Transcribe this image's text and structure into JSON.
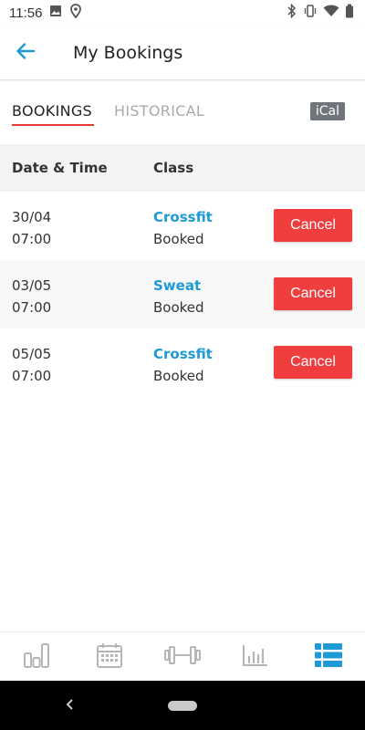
{
  "status_bar": {
    "time": "11:56",
    "left_icons": [
      "image-icon",
      "location-pin-icon"
    ],
    "right_icons": [
      "bluetooth-icon",
      "vibrate-icon",
      "wifi-icon",
      "battery-icon"
    ]
  },
  "app_bar": {
    "title": "My Bookings",
    "back_icon": "arrow-left-icon",
    "accent_color": "#1e9ad6"
  },
  "tabs": {
    "items": [
      {
        "label": "BOOKINGS",
        "active": true
      },
      {
        "label": "HISTORICAL",
        "active": false
      }
    ],
    "ical_label": "iCal",
    "underline_color": "#e53935"
  },
  "table": {
    "headers": {
      "date": "Date & Time",
      "class": "Class"
    },
    "rows": [
      {
        "date": "30/04",
        "time": "07:00",
        "class_name": "Crossfit",
        "status": "Booked",
        "action": "Cancel"
      },
      {
        "date": "03/05",
        "time": "07:00",
        "class_name": "Sweat",
        "status": "Booked",
        "action": "Cancel"
      },
      {
        "date": "05/05",
        "time": "07:00",
        "class_name": "Crossfit",
        "status": "Booked",
        "action": "Cancel"
      }
    ],
    "cancel_color": "#f03e3e"
  },
  "bottom_nav": {
    "items": [
      {
        "icon": "bar-chart-icon",
        "active": false
      },
      {
        "icon": "calendar-icon",
        "active": false
      },
      {
        "icon": "dumbbell-icon",
        "active": false
      },
      {
        "icon": "stats-icon",
        "active": false
      },
      {
        "icon": "list-icon",
        "active": true
      }
    ],
    "active_color": "#1e9ad6",
    "inactive_color": "#b5b5b5"
  }
}
